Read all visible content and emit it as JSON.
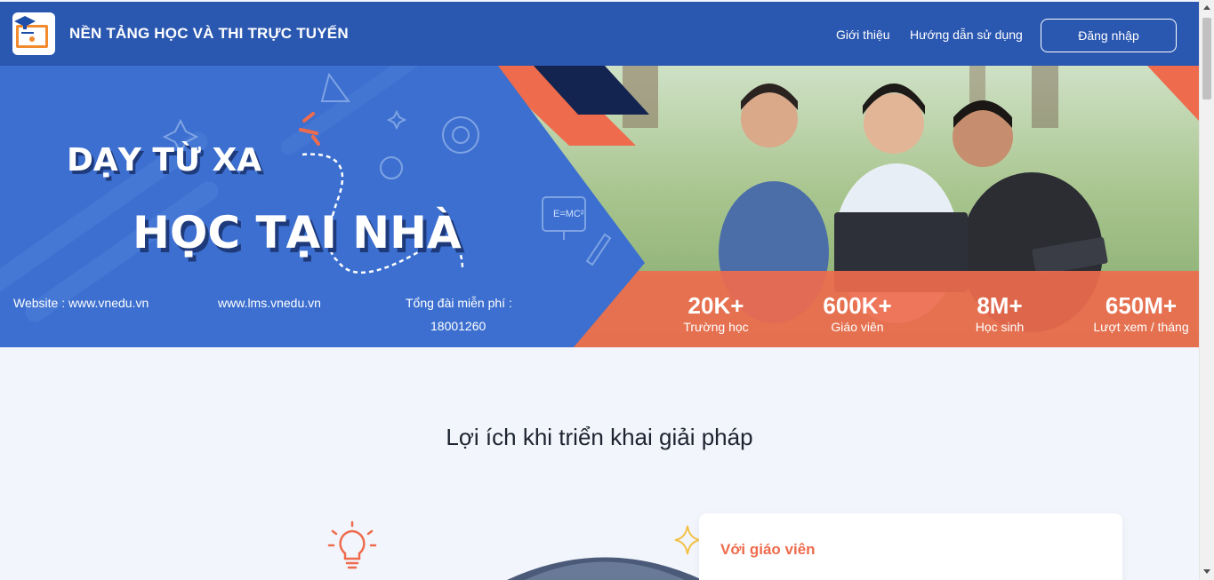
{
  "header": {
    "title": "NỀN TẢNG HỌC VÀ THI TRỰC TUYẾN",
    "nav": [
      "Giới thiệu",
      "Hướng dẫn sử dụng"
    ],
    "login_label": "Đăng nhập"
  },
  "banner": {
    "headline_1": "DẠY TỪ XA",
    "headline_2": "HỌC TẠI NHÀ",
    "board_text": "E=MC²",
    "website_label": "Website : www.vnedu.vn",
    "lms_label": "www.lms.vnedu.vn",
    "hotline_label": "Tổng đài miễn phí :",
    "hotline_number": "18001260",
    "stats": [
      {
        "value": "20K+",
        "label": "Trường học"
      },
      {
        "value": "600K+",
        "label": "Giáo viên"
      },
      {
        "value": "8M+",
        "label": "Học sinh"
      },
      {
        "value": "650M+",
        "label": "Lượt xem / tháng"
      }
    ]
  },
  "benefits": {
    "title": "Lợi ích khi triển khai giải pháp",
    "teacher_card_title": "Với giáo viên"
  },
  "colors": {
    "header_bg": "#2a57b0",
    "banner_blue": "#3c6fcf",
    "accent_orange": "#ee6b4d",
    "page_bg": "#f2f5fb"
  }
}
